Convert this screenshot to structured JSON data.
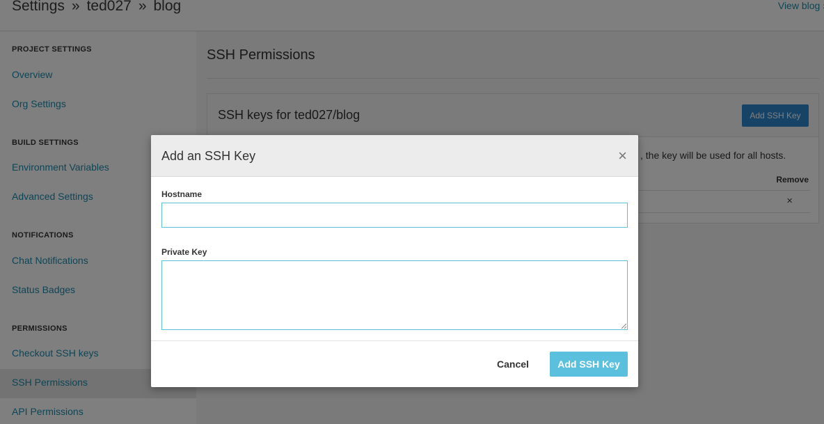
{
  "header": {
    "breadcrumb": [
      "Settings",
      "ted027",
      "blog"
    ],
    "separator": "»",
    "view_link": "View blog »"
  },
  "sidebar": {
    "sections": [
      {
        "heading": "PROJECT SETTINGS",
        "items": [
          "Overview",
          "Org Settings"
        ]
      },
      {
        "heading": "BUILD SETTINGS",
        "items": [
          "Environment Variables",
          "Advanced Settings"
        ]
      },
      {
        "heading": "NOTIFICATIONS",
        "items": [
          "Chat Notifications",
          "Status Badges"
        ]
      },
      {
        "heading": "PERMISSIONS",
        "items": [
          "Checkout SSH keys",
          "SSH Permissions",
          "API Permissions"
        ]
      }
    ],
    "active_item": "SSH Permissions"
  },
  "main": {
    "title": "SSH Permissions",
    "panel": {
      "title": "SSH keys for ted027/blog",
      "add_button": "Add SSH Key",
      "note_fragment": ", the key will be used for all hosts.",
      "columns": {
        "remove": "Remove"
      },
      "row_remove_icon": "×"
    }
  },
  "modal": {
    "title": "Add an SSH Key",
    "close_icon": "×",
    "hostname": {
      "label": "Hostname",
      "value": "",
      "placeholder": ""
    },
    "private_key": {
      "label": "Private Key",
      "value": "",
      "placeholder": ""
    },
    "cancel_label": "Cancel",
    "submit_label": "Add SSH Key"
  },
  "colors": {
    "link": "#1d8bad",
    "primary_button": "#2f87cf",
    "modal_button": "#5bc0de",
    "input_border": "#5bc0de"
  }
}
